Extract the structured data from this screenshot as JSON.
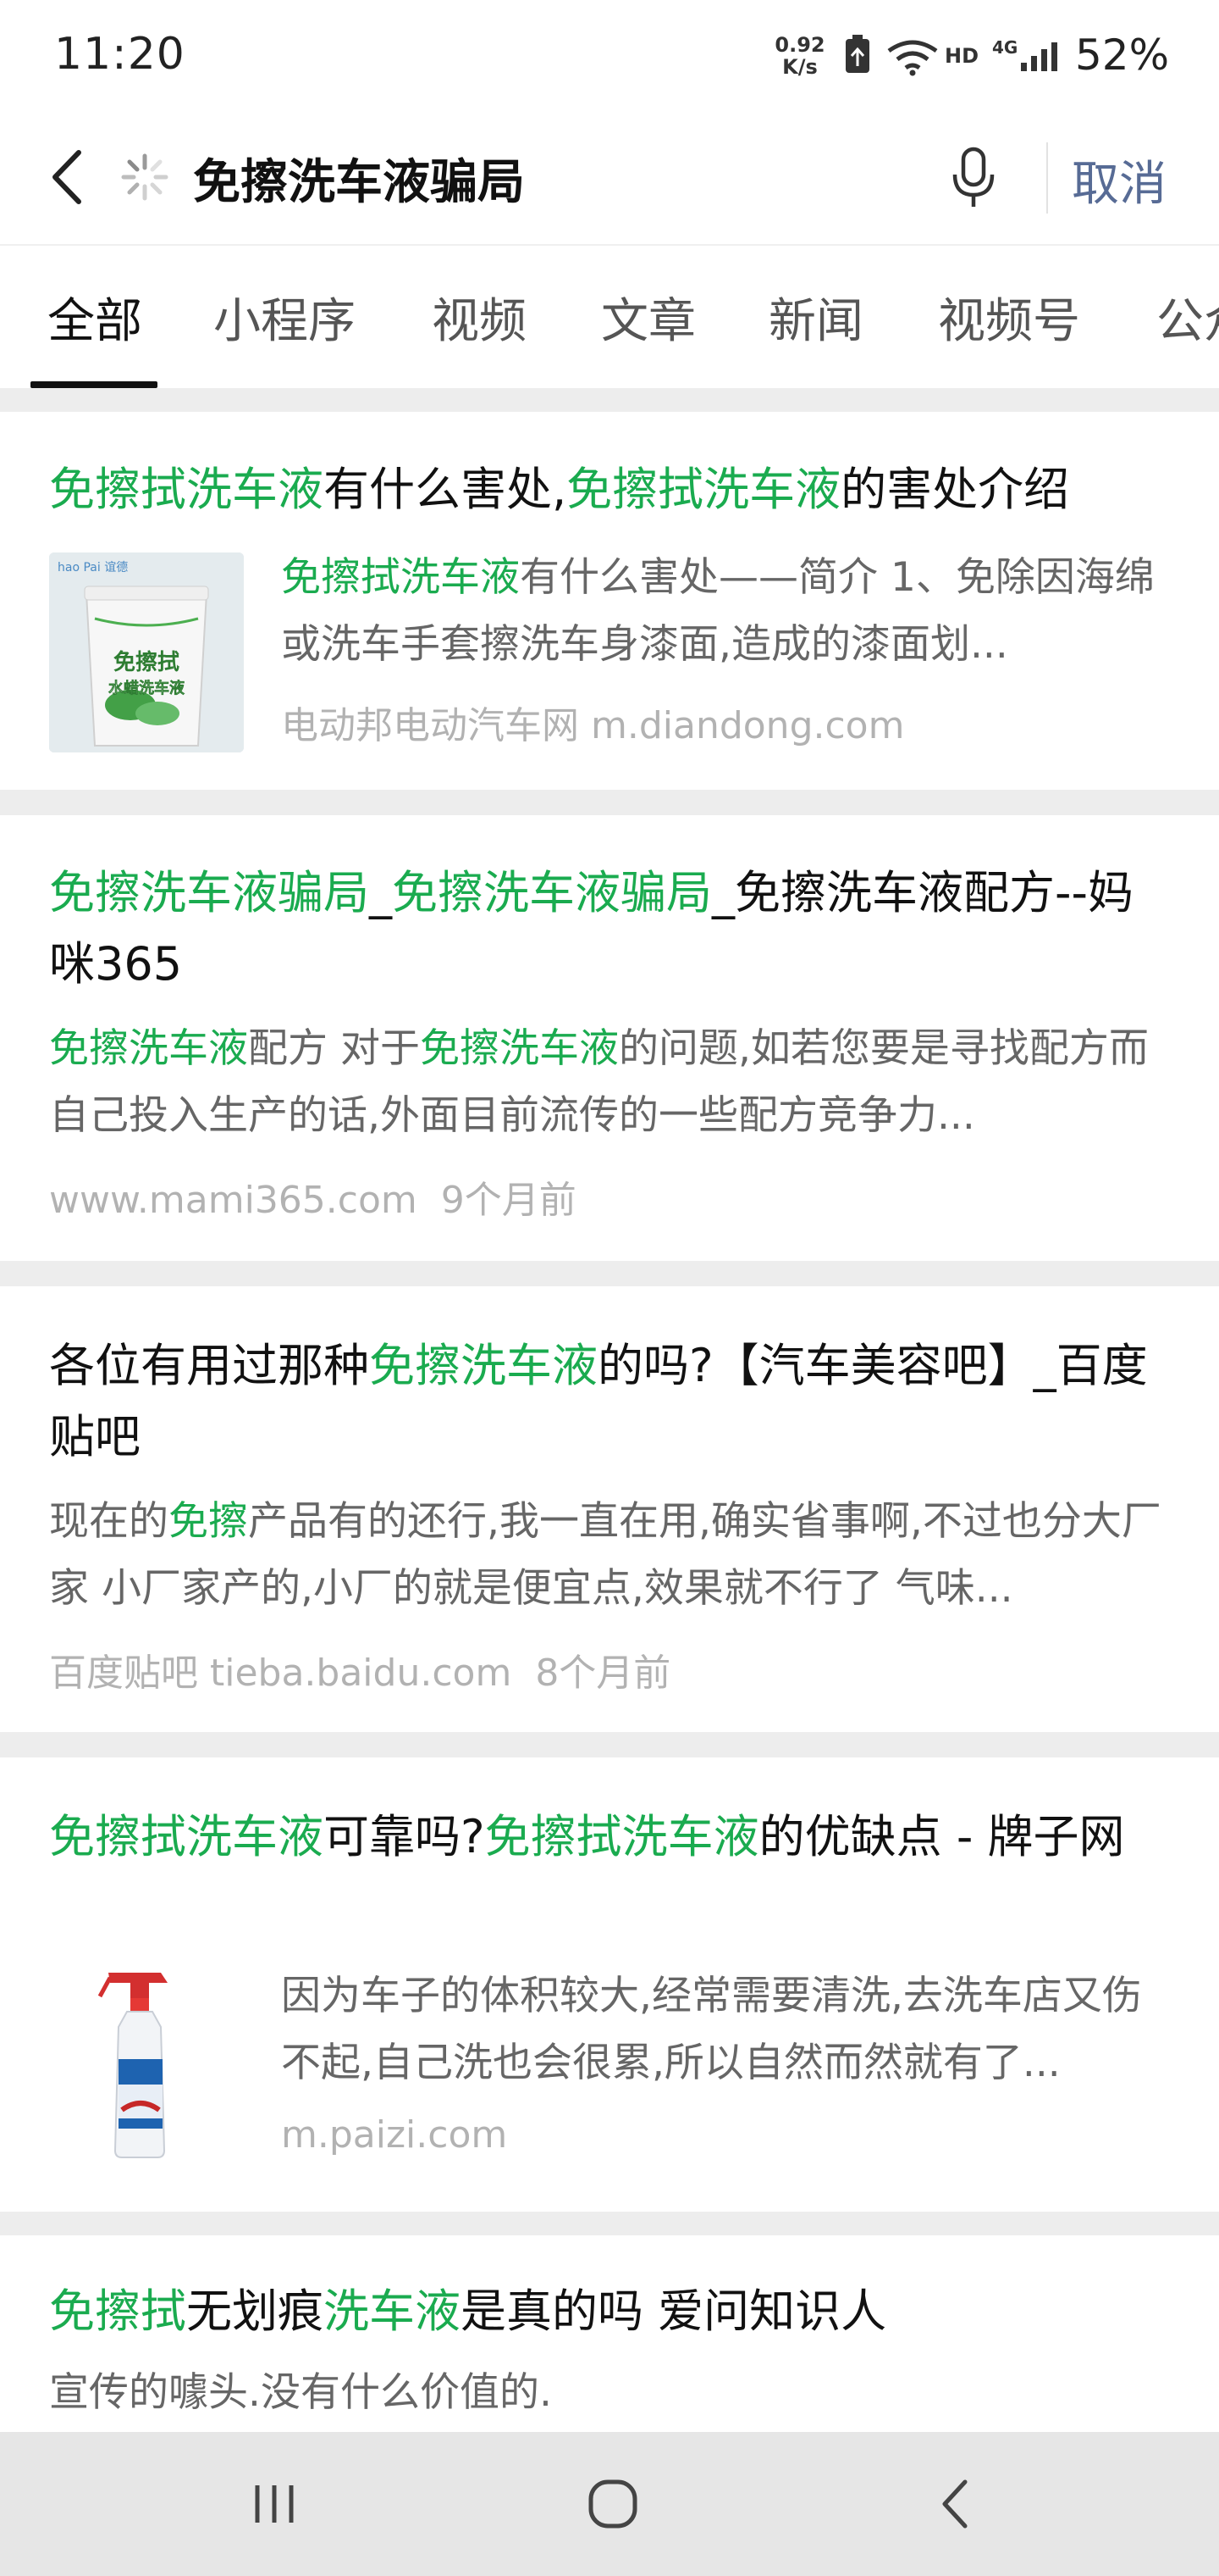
{
  "status_bar": {
    "time": "11:20",
    "net_speed_value": "0.92",
    "net_speed_unit": "K/s",
    "hd": "HD",
    "network": "4G",
    "battery": "52%"
  },
  "search": {
    "query": "免擦洗车液骗局",
    "cancel_label": "取消"
  },
  "tabs": [
    "全部",
    "小程序",
    "视频",
    "文章",
    "新闻",
    "视频号",
    "公众号"
  ],
  "results": [
    {
      "title_parts": [
        "免擦拭洗车液",
        "有什么害处,",
        "免擦拭洗车液",
        "的害处介绍"
      ],
      "snippet_parts": [
        "免擦拭洗车液",
        "有什么害处——简介 1、免除因海绵或洗车手套擦洗车身漆面,造成的漆面划..."
      ],
      "source": "电动邦电动汽车网 m.diandong.com",
      "time": ""
    },
    {
      "title_parts": [
        "免擦洗车液骗局",
        "_",
        "免擦洗车液骗局",
        "_免擦洗车液配方--妈咪365"
      ],
      "snippet_parts": [
        "免擦洗车液",
        "配方 对于",
        "免擦洗车液",
        "的问题,如若您要是寻找配方而自己投入生产的话,外面目前流传的一些配方竞争力..."
      ],
      "source": "www.mami365.com",
      "time": "9个月前"
    },
    {
      "title_parts": [
        "各位有用过那种",
        "免擦洗车液",
        "的吗?【汽车美容吧】_百度贴吧"
      ],
      "snippet_parts": [
        "现在的",
        "免擦",
        "产品有的还行,我一直在用,确实省事啊,不过也分大厂家 小厂家产的,小厂的就是便宜点,效果就不行了 气味..."
      ],
      "source": "百度贴吧 tieba.baidu.com",
      "time": "8个月前"
    },
    {
      "title_parts": [
        "免擦拭洗车液",
        "可靠吗?",
        "免擦拭洗车液",
        "的优缺点 - 牌子网"
      ],
      "snippet_parts": [
        "因为车子的体积较大,经常需要清洗,去洗车店又伤不起,自己洗也会很累,所以自然而然就有了..."
      ],
      "source": "m.paizi.com",
      "time": ""
    },
    {
      "title_parts": [
        "免擦拭",
        "无划痕",
        "洗车液",
        "是真的吗 爱问知识人"
      ],
      "snippet_parts": [
        "宣传的噱头.没有什么价值的."
      ],
      "source": "",
      "time": ""
    }
  ],
  "thumbnails": {
    "bucket_brand": "hao Pai 谊德",
    "bucket_label_line1": "免擦拭",
    "bucket_label_line2": "水蜡洗车液"
  },
  "icons": {
    "back": "back-arrow-icon",
    "loading": "loading-spinner-icon",
    "mic": "microphone-icon",
    "nav_recent": "recent-apps-icon",
    "nav_home": "home-icon",
    "nav_back": "nav-back-icon"
  },
  "colors": {
    "highlight": "#1aab4f",
    "link_blue": "#576b95",
    "snippet_gray": "#666666",
    "source_gray": "#b2b2b2",
    "background": "#ededed"
  }
}
